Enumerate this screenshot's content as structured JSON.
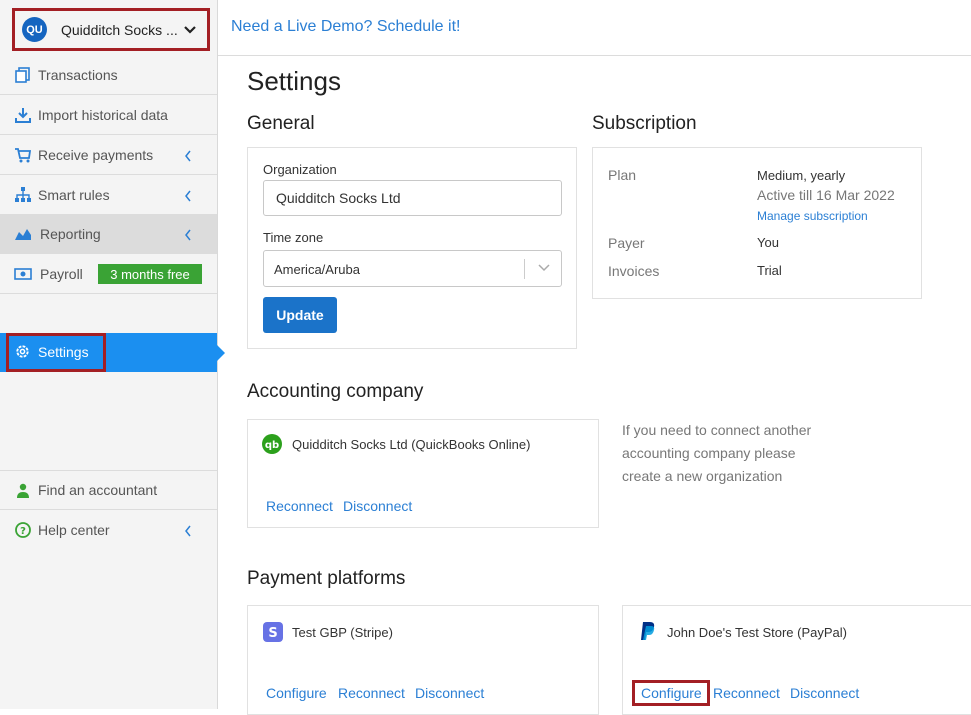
{
  "sidebar": {
    "org": {
      "initials": "QU",
      "name": "Quidditch Socks ..."
    },
    "items": [
      {
        "label": "Transactions",
        "icon": "copy-icon"
      },
      {
        "label": "Import historical data",
        "icon": "download-icon"
      },
      {
        "label": "Receive payments",
        "icon": "cart-icon"
      },
      {
        "label": "Smart rules",
        "icon": "hierarchy-icon"
      },
      {
        "label": "Reporting",
        "icon": "area-chart-icon"
      },
      {
        "label": "Payroll",
        "icon": "money-icon",
        "badge": "3 months free"
      },
      {
        "label": "Settings",
        "icon": "gear-icon"
      },
      {
        "label": "Find an accountant",
        "icon": "user-icon"
      },
      {
        "label": "Help center",
        "icon": "question-icon"
      }
    ]
  },
  "topbar": {
    "demo_link": "Need a Live Demo? Schedule it!"
  },
  "page": {
    "title": "Settings"
  },
  "general": {
    "heading": "General",
    "org_label": "Organization",
    "org_value": "Quidditch Socks Ltd",
    "tz_label": "Time zone",
    "tz_value": "America/Aruba",
    "update_label": "Update"
  },
  "subscription": {
    "heading": "Subscription",
    "plan_label": "Plan",
    "plan_value": "Medium, yearly",
    "active_text": "Active till 16 Mar 2022",
    "manage_link": "Manage subscription",
    "payer_label": "Payer",
    "payer_value": "You",
    "invoices_label": "Invoices",
    "invoices_value": "Trial"
  },
  "accounting": {
    "heading": "Accounting company",
    "company_name": "Quidditch Socks Ltd (QuickBooks Online)",
    "reconnect": "Reconnect",
    "disconnect": "Disconnect",
    "help_lines": [
      "If you need to connect another",
      "accounting company please",
      "create a new organization"
    ]
  },
  "payment": {
    "heading": "Payment platforms",
    "platforms": [
      {
        "name": "Test GBP (Stripe)",
        "configure": "Configure",
        "reconnect": "Reconnect",
        "disconnect": "Disconnect"
      },
      {
        "name": "John Doe's Test Store (PayPal)",
        "configure": "Configure",
        "reconnect": "Reconnect",
        "disconnect": "Disconnect"
      }
    ]
  },
  "colors": {
    "accent": "#1b8ff0",
    "link": "#2b7fd4",
    "badge": "#3aa335",
    "highlight": "#a31f24",
    "button": "#1b73c9"
  }
}
